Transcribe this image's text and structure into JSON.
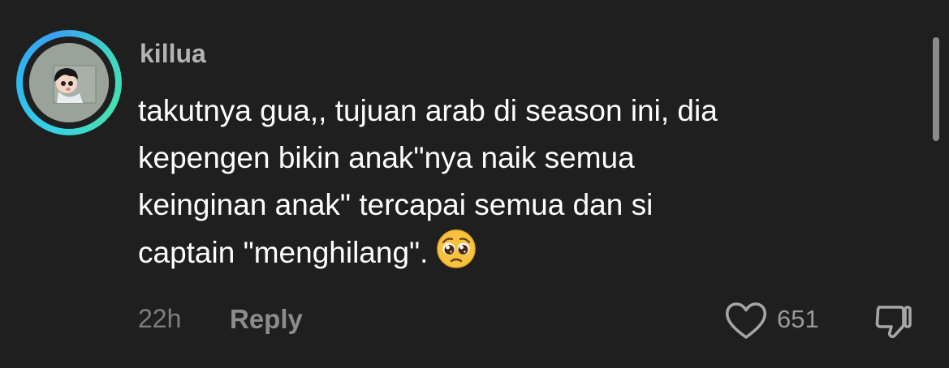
{
  "comment": {
    "username": "killua",
    "text_lines": [
      "takutnya gua,, tujuan arab di season ini, dia",
      "kepengen bikin anak\"nya naik semua",
      "keinginan anak\" tercapai semua dan si",
      "captain \"menghilang\"."
    ],
    "emoji": "pleading-face",
    "time": "22h",
    "reply_label": "Reply",
    "like_count": "651"
  },
  "icons": {
    "like": "heart-outline-icon",
    "dislike": "thumbs-down-icon"
  },
  "colors": {
    "background": "#1f1f1f",
    "ring_accent": "#35d0e8",
    "text_primary": "#ffffff",
    "text_secondary": "#8c8c8c"
  }
}
